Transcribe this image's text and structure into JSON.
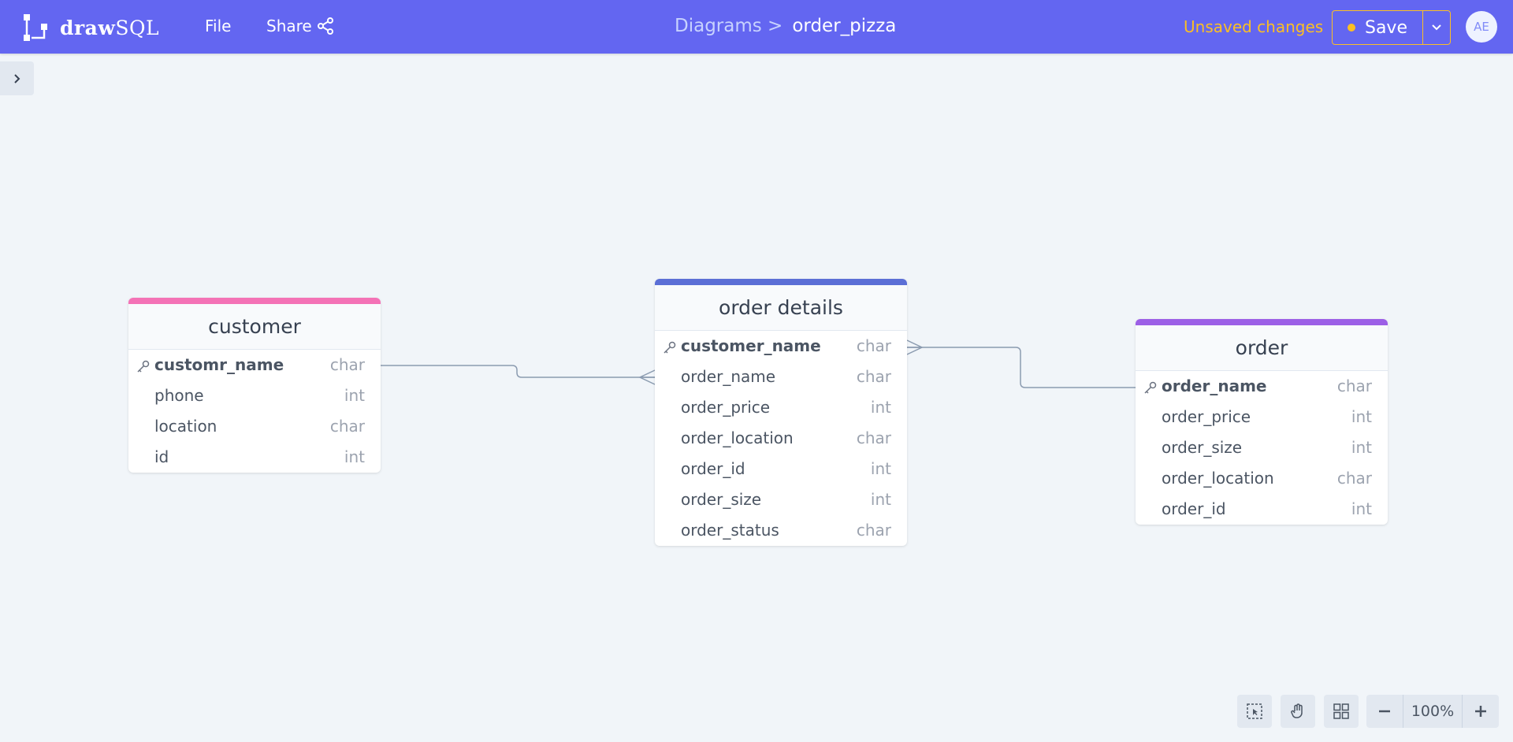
{
  "app": {
    "logo_bold": "draw",
    "logo_light": "SQL"
  },
  "menu": {
    "file": "File",
    "share": "Share"
  },
  "breadcrumb": {
    "parent": "Diagrams >",
    "current": "order_pizza"
  },
  "status": {
    "unsaved": "Unsaved changes"
  },
  "save": {
    "label": "Save"
  },
  "user": {
    "initials": "AE"
  },
  "colors": {
    "topbar": "#6366f1",
    "customer": "#f472b6",
    "order_details": "#5b6fd6",
    "order": "#9c5fe6",
    "unsaved": "#fbbf24"
  },
  "tables": {
    "customer": {
      "title": "customer",
      "rows": [
        {
          "name": "customr_name",
          "type": "char",
          "key": true
        },
        {
          "name": "phone",
          "type": "int"
        },
        {
          "name": "location",
          "type": "char"
        },
        {
          "name": "id",
          "type": "int"
        }
      ]
    },
    "order_details": {
      "title": "order details",
      "rows": [
        {
          "name": "customer_name",
          "type": "char",
          "key": true
        },
        {
          "name": "order_name",
          "type": "char"
        },
        {
          "name": "order_price",
          "type": "int"
        },
        {
          "name": "order_location",
          "type": "char"
        },
        {
          "name": "order_id",
          "type": "int"
        },
        {
          "name": "order_size",
          "type": "int"
        },
        {
          "name": "order_status",
          "type": "char"
        }
      ]
    },
    "order": {
      "title": "order",
      "rows": [
        {
          "name": "order_name",
          "type": "char",
          "key": true
        },
        {
          "name": "order_price",
          "type": "int"
        },
        {
          "name": "order_size",
          "type": "int"
        },
        {
          "name": "order_location",
          "type": "char"
        },
        {
          "name": "order_id",
          "type": "int"
        }
      ]
    }
  },
  "zoom": {
    "level": "100%"
  },
  "icons": [
    "select-icon",
    "hand-icon",
    "grid-icon",
    "zoom-out-icon",
    "zoom-in-icon",
    "chevron-right-icon",
    "chevron-down-icon",
    "share-icon",
    "key-icon"
  ]
}
